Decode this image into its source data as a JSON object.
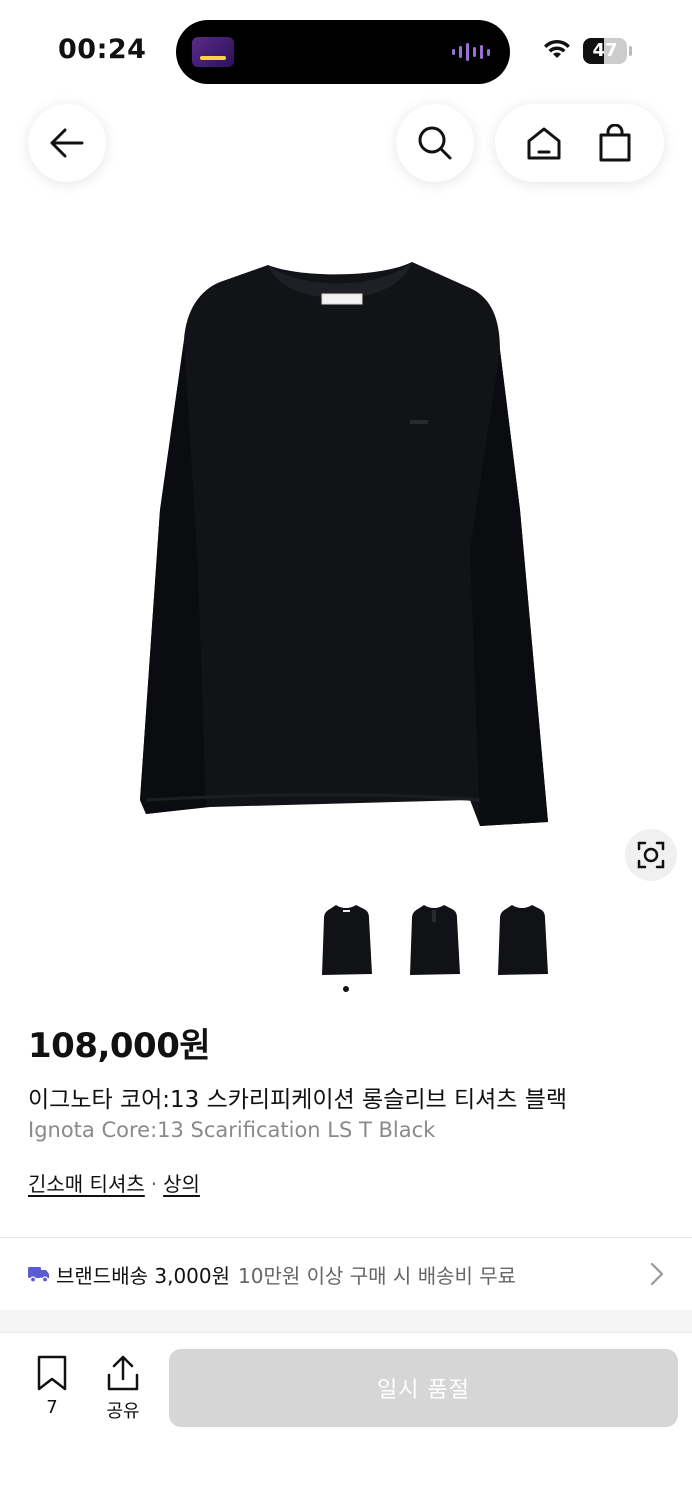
{
  "status_bar": {
    "time": "00:24",
    "battery": "47",
    "battery_level": 0.47
  },
  "nav": {
    "back_icon": "arrow-left-icon",
    "search_icon": "search-icon",
    "home_icon": "home-icon",
    "cart_icon": "shopping-bag-icon"
  },
  "product": {
    "image_alt": "black long sleeve t-shirt",
    "price": "108,000원",
    "name_ko": "이그노타 코어:13 스카리피케이션 롱슬리브 티셔츠 블랙",
    "name_en": "Ignota Core:13 Scarification LS T Black",
    "categories": [
      "긴소매 티셔츠",
      "상의"
    ],
    "category_separator": "·",
    "thumbnail_count": 3,
    "active_thumbnail": 0
  },
  "shipping": {
    "main": "브랜드배송 3,000원",
    "sub": "10만원 이상 구매 시 배송비 무료",
    "accent": "#5b5bd6"
  },
  "bottom_bar": {
    "bookmark_count": "7",
    "share_label": "공유",
    "buy_label": "일시 품절"
  }
}
